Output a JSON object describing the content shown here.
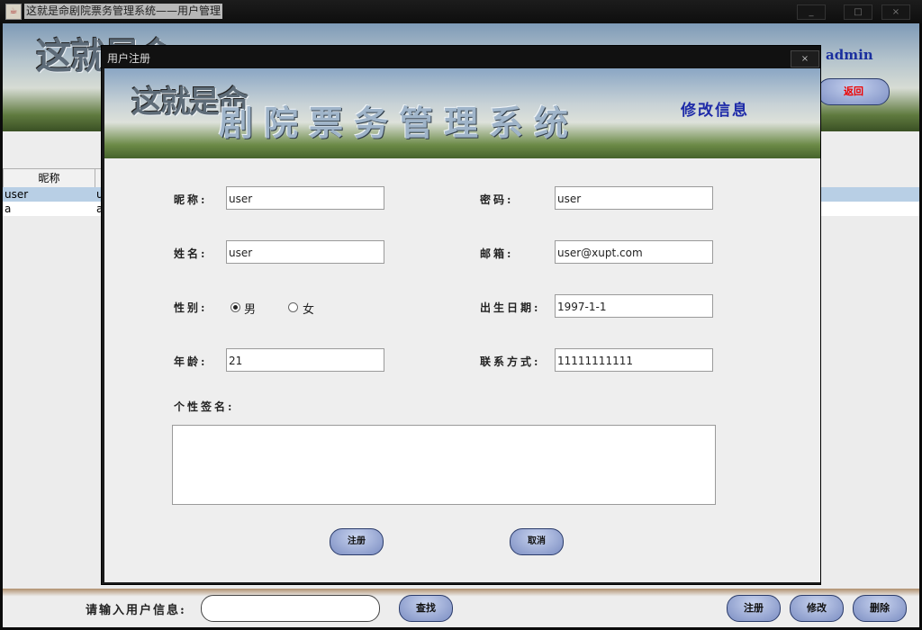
{
  "window": {
    "title": "这就是命剧院票务管理系统——用户管理",
    "app_icon": "java-icon",
    "controls": {
      "minimize": "_",
      "maximize": "□",
      "close": "×"
    }
  },
  "main": {
    "logo_text": "这就是命",
    "user": "admin",
    "back_button": "返回",
    "table": {
      "headers": [
        "昵称",
        ""
      ],
      "rows": [
        [
          "user",
          "u"
        ],
        [
          "a",
          "a"
        ]
      ]
    },
    "bottom": {
      "search_label": "请输入用户信息:",
      "search_value": "",
      "search_button": "查找",
      "register_button": "注册",
      "edit_button": "修改",
      "delete_button": "删除"
    }
  },
  "dialog": {
    "title": "用户注册",
    "close": "×",
    "logo_text": "这就是命",
    "banner_title": "剧院票务管理系统",
    "banner_subtitle": "修改信息",
    "labels": {
      "nickname": "昵称:",
      "password": "密码:",
      "name": "姓名:",
      "email": "邮箱:",
      "gender": "性别:",
      "birthday": "出生日期:",
      "age": "年龄:",
      "contact": "联系方式:",
      "signature": "个性签名:"
    },
    "values": {
      "nickname": "user",
      "password": "user",
      "name": "user",
      "email": "user@xupt.com",
      "birthday": "1997-1-1",
      "age": "21",
      "contact": "11111111111",
      "signature": ""
    },
    "gender": {
      "male": "男",
      "female": "女",
      "selected": "male"
    },
    "register_button": "注册",
    "cancel_button": "取消"
  }
}
